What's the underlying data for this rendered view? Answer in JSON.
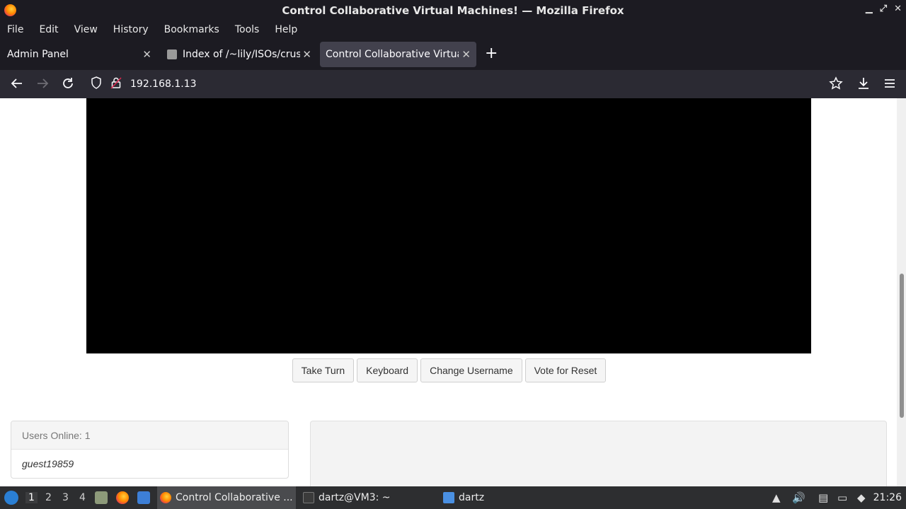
{
  "window": {
    "title": "Control Collaborative Virtual Machines! — Mozilla Firefox",
    "controls": [
      "▁",
      "⤢",
      "✕"
    ]
  },
  "menubar": {
    "items": [
      "File",
      "Edit",
      "View",
      "History",
      "Bookmarks",
      "Tools",
      "Help"
    ]
  },
  "tabs": [
    {
      "label": "Admin Panel",
      "active": false
    },
    {
      "label": "Index of /~lily/ISOs/crust",
      "active": false
    },
    {
      "label": "Control Collaborative Virtual",
      "active": true
    }
  ],
  "navbar": {
    "url": "192.168.1.13"
  },
  "page": {
    "buttons": [
      "Take Turn",
      "Keyboard",
      "Change Username",
      "Vote for Reset"
    ],
    "users_header": "Users Online: 1",
    "users": [
      "guest19859"
    ]
  },
  "taskbar": {
    "workspaces": [
      "1",
      "2",
      "3",
      "4"
    ],
    "tasks": [
      {
        "label": "Control Collaborative ...",
        "icon": "firefox-icon"
      },
      {
        "label": "dartz@VM3: ~",
        "icon": "terminal-icon"
      },
      {
        "label": "dartz",
        "icon": "folder-icon"
      }
    ],
    "clock": "21:26"
  },
  "colors": {
    "chrome_dark": "#1c1b22",
    "toolbar": "#2b2a33",
    "active_tab": "#42414d",
    "taskbar": "#2d2e30"
  }
}
